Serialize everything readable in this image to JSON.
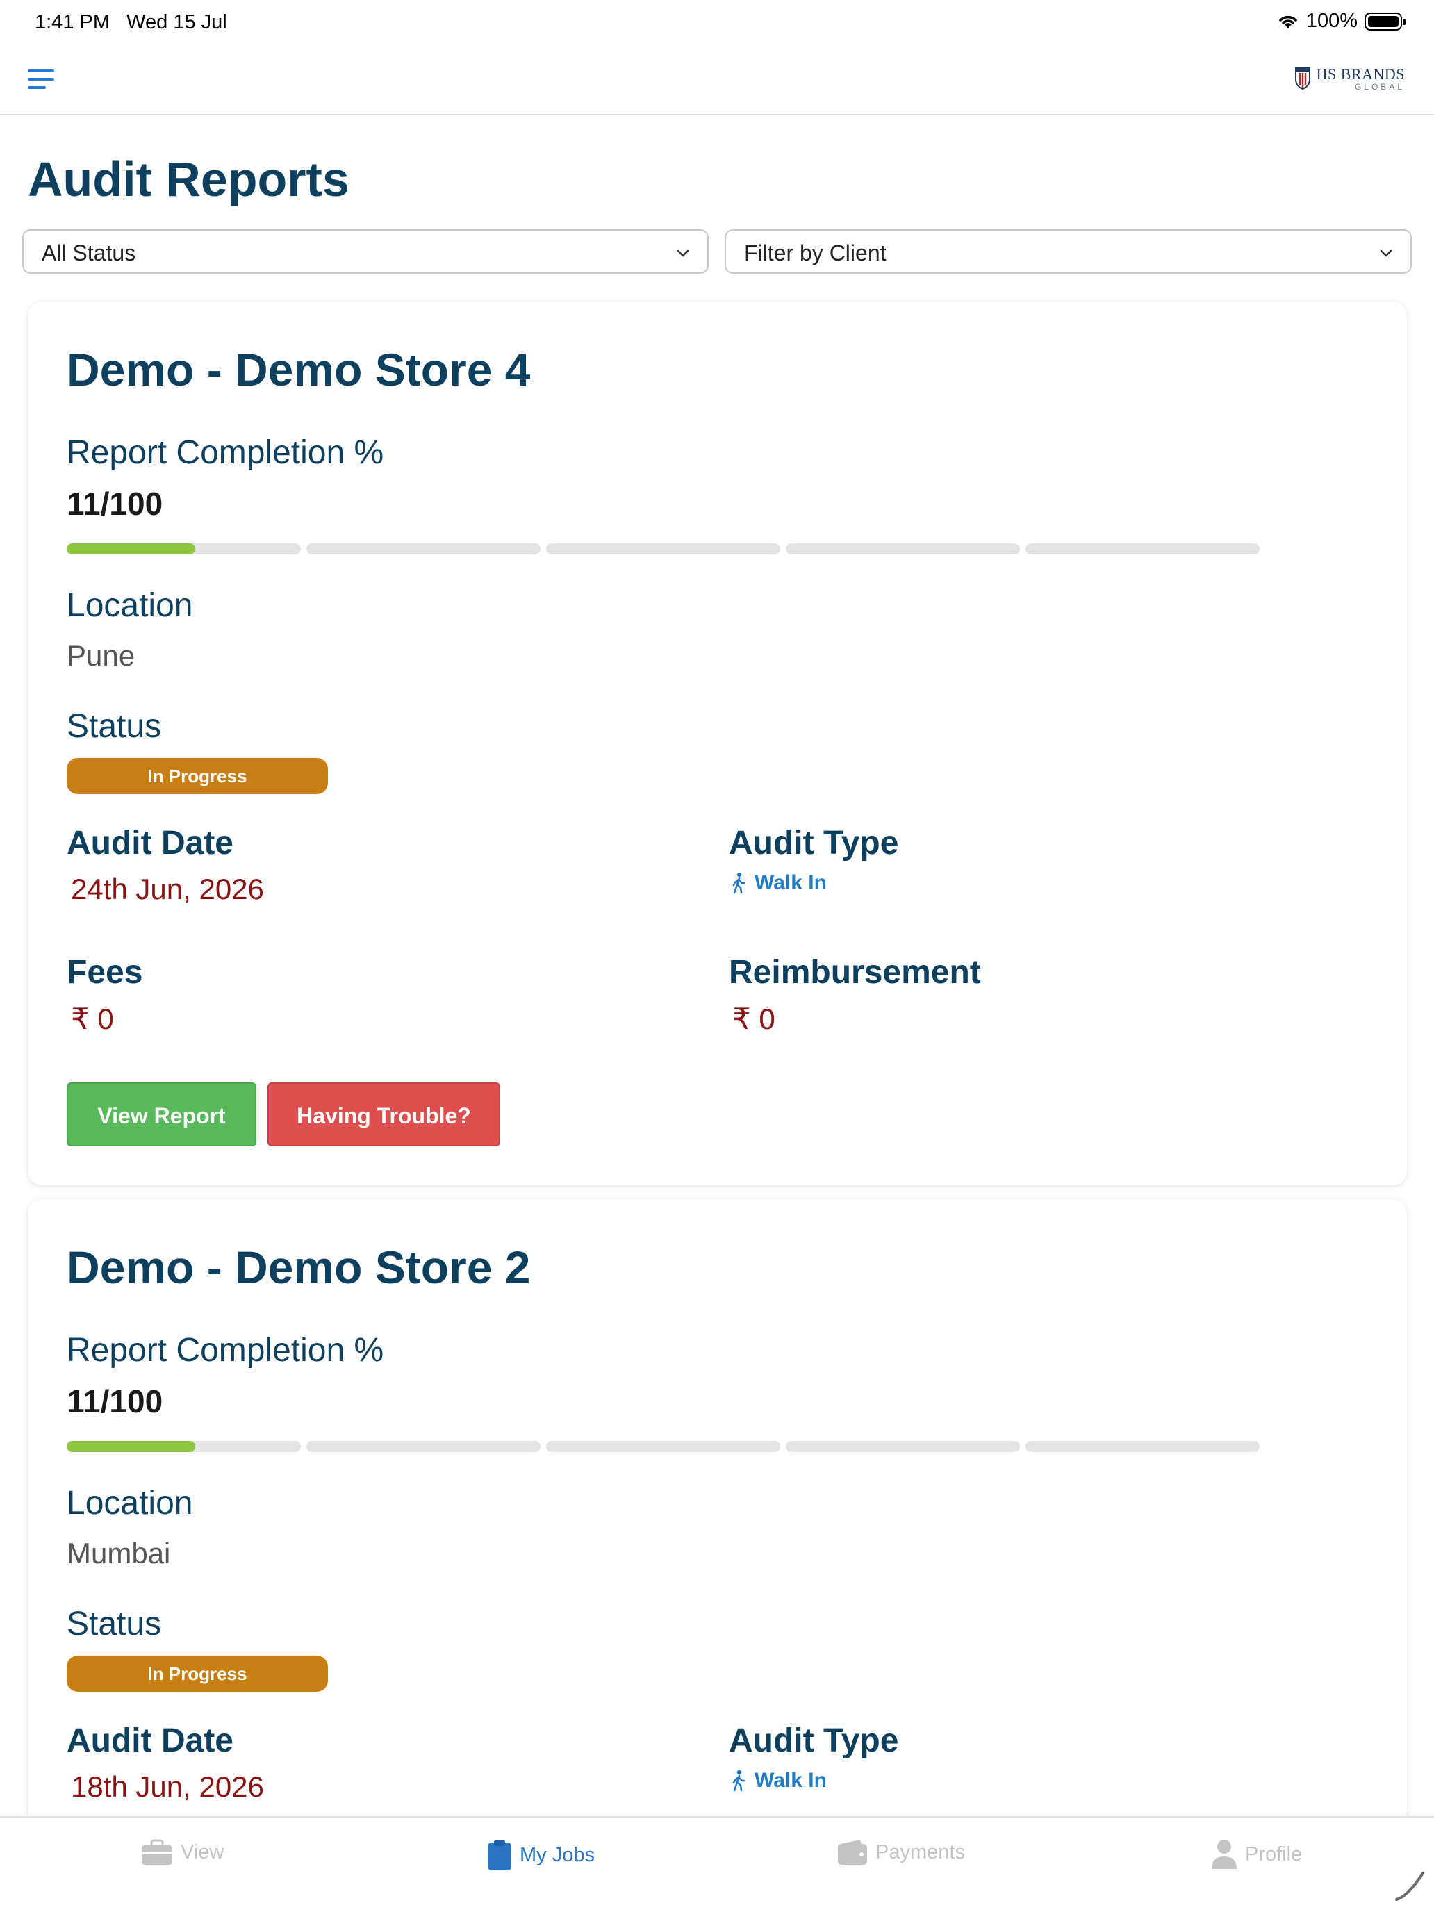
{
  "status_bar": {
    "time": "1:41 PM",
    "date": "Wed 15 Jul",
    "battery": "100%"
  },
  "header": {
    "brand_name": "HS BRANDS",
    "brand_sub": "GLOBAL"
  },
  "page": {
    "title": "Audit Reports"
  },
  "filters": {
    "status": "All Status",
    "client": "Filter by Client"
  },
  "labels": {
    "completion": "Report Completion %",
    "location": "Location",
    "status": "Status",
    "audit_date": "Audit Date",
    "audit_type": "Audit Type",
    "fees": "Fees",
    "reimbursement": "Reimbursement",
    "view_report": "View Report",
    "having_trouble": "Having Trouble?"
  },
  "reports": [
    {
      "title": "Demo - Demo Store 4",
      "completion_text": "11/100",
      "completion_fraction": 0.11,
      "location": "Pune",
      "status": "In Progress",
      "audit_date": "24th Jun, 2026",
      "audit_type": "Walk In",
      "fees": "₹ 0",
      "reimbursement": "₹ 0"
    },
    {
      "title": "Demo - Demo Store 2",
      "completion_text": "11/100",
      "completion_fraction": 0.11,
      "location": "Mumbai",
      "status": "In Progress",
      "audit_date": "18th Jun, 2026",
      "audit_type": "Walk In"
    }
  ],
  "tabs": [
    {
      "label": "View",
      "icon": "briefcase-icon",
      "active": false
    },
    {
      "label": "My Jobs",
      "icon": "clipboard-icon",
      "active": true
    },
    {
      "label": "Payments",
      "icon": "wallet-icon",
      "active": false
    },
    {
      "label": "Profile",
      "icon": "person-icon",
      "active": false
    }
  ],
  "colors": {
    "primary_text": "#0d3f5e",
    "progress_fill": "#8dc63f",
    "status_badge": "#c77f14",
    "date_text": "#8a1212",
    "view_button": "#57b95a",
    "trouble_button": "#dd4f4f",
    "active_tab": "#2a73c3"
  }
}
